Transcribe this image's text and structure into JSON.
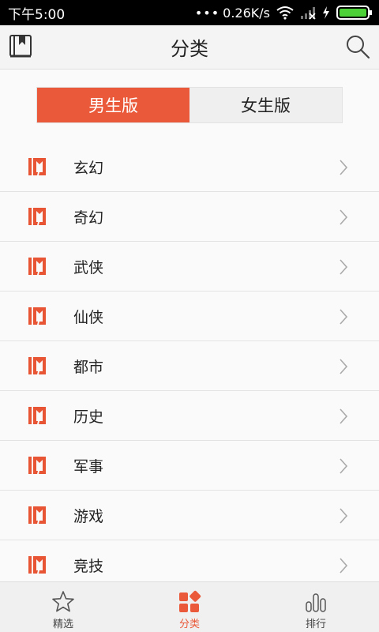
{
  "status_bar": {
    "time": "下午5:00",
    "network_speed": "0.26K/s"
  },
  "header": {
    "title": "分类",
    "left_icon": "bookshelf-icon",
    "right_icon": "search-icon"
  },
  "segment": {
    "options": [
      "男生版",
      "女生版"
    ],
    "selected": "男生版"
  },
  "categories": [
    {
      "label": "玄幻"
    },
    {
      "label": "奇幻"
    },
    {
      "label": "武侠"
    },
    {
      "label": "仙侠"
    },
    {
      "label": "都市"
    },
    {
      "label": "历史"
    },
    {
      "label": "军事"
    },
    {
      "label": "游戏"
    },
    {
      "label": "竞技"
    }
  ],
  "bottom_nav": {
    "tabs": [
      {
        "label": "精选",
        "icon": "star-icon"
      },
      {
        "label": "分类",
        "icon": "category-icon"
      },
      {
        "label": "排行",
        "icon": "ranking-icon"
      }
    ],
    "active": "分类"
  },
  "colors": {
    "accent": "#ea5a3a",
    "status_bar": "#000000",
    "header_bg": "#f4f4f4",
    "battery": "#4cd137"
  }
}
